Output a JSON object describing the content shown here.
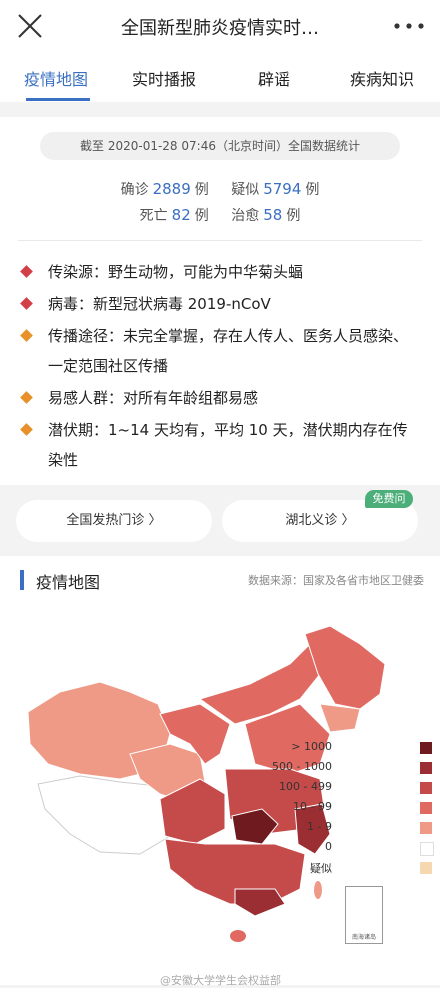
{
  "header": {
    "title": "全国新型肺炎疫情实时…"
  },
  "tabs": [
    "疫情地图",
    "实时播报",
    "辟谣",
    "疾病知识"
  ],
  "summary": {
    "timestamp": "截至 2020-01-28 07:46（北京时间）全国数据统计",
    "confirmed_label": "确诊",
    "confirmed": "2889",
    "suspected_label": "疑似",
    "suspected": "5794",
    "deaths_label": "死亡",
    "deaths": "82",
    "recovered_label": "治愈",
    "recovered": "58",
    "unit": "例"
  },
  "facts": [
    {
      "text": "传染源：野生动物，可能为中华菊头蝠",
      "color": "#d33f49"
    },
    {
      "text": "病毒：新型冠状病毒 2019-nCoV",
      "color": "#d33f49"
    },
    {
      "text": "传播途径：未完全掌握，存在人传人、医务人员感染、一定范围社区传播",
      "color": "#e8902a"
    },
    {
      "text": "易感人群：对所有年龄组都易感",
      "color": "#e8902a"
    },
    {
      "text": "潜伏期：1~14 天均有，平均 10 天，潜伏期内存在传染性",
      "color": "#e8902a"
    }
  ],
  "buttons": {
    "fever_clinic": "全国发热门诊 〉",
    "hubei_consult": "湖北义诊 〉",
    "free_badge": "免费问"
  },
  "map": {
    "title": "疫情地图",
    "source": "数据来源：国家及各省市地区卫健委",
    "legend": [
      {
        "label": "> 1000",
        "color": "#6e1a1f"
      },
      {
        "label": "500 - 1000",
        "color": "#9b2e33"
      },
      {
        "label": "100 - 499",
        "color": "#c54a4a"
      },
      {
        "label": "10 - 99",
        "color": "#e06a62"
      },
      {
        "label": "1 - 9",
        "color": "#ef9a86"
      },
      {
        "label": "0",
        "color": "#ffffff"
      },
      {
        "label": "疑似",
        "color": "#f5d7b0"
      }
    ],
    "scs_label": "南海诸岛",
    "watermark": "@安徽大学学生会权益部"
  }
}
